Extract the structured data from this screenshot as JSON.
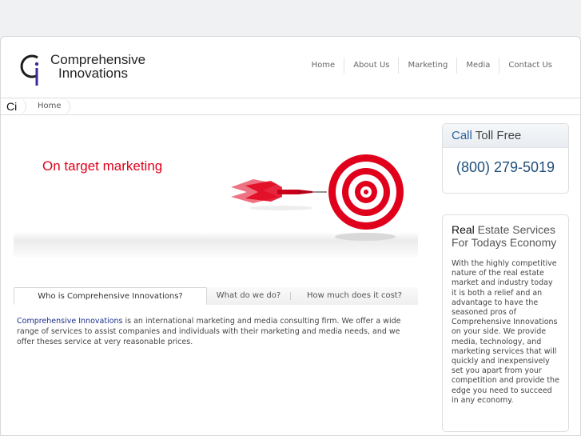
{
  "brand": {
    "line1": "Comprehensive",
    "line2": "Innovations",
    "mark": "ci-logo-mark"
  },
  "nav": {
    "items": [
      {
        "label": "Home"
      },
      {
        "label": "About Us"
      },
      {
        "label": "Marketing"
      },
      {
        "label": "Media"
      },
      {
        "label": "Contact Us"
      }
    ]
  },
  "breadcrumb": {
    "ci": "Ci",
    "home": "Home"
  },
  "hero": {
    "title": "On target marketing",
    "art": "dart-and-target-icon"
  },
  "tabs": [
    {
      "label": "Who is Comprehensive Innovations?"
    },
    {
      "label": "What do we do?"
    },
    {
      "label": "How much does it cost?"
    }
  ],
  "about": {
    "brand_link": "Comprehensive Innovations",
    "text": " is an international marketing and media consulting firm. We offer a wide range of services to assist companies and individuals with their marketing and media needs, and we offer theses service at very reasonable prices."
  },
  "call": {
    "highlight": "Call",
    "rest": " Toll Free",
    "number": "(800) 279-5019"
  },
  "realestate": {
    "highlight": "Real",
    "title_rest": " Estate Services For Todays Economy",
    "body": "With the highly competitive nature of the real estate market and industry today it is both a relief and an advantage to have the seasoned pros of Comprehensive Innovations on your side. We provide media, technology, and marketing services that will quickly and inexpensively set you apart from your competition and provide the edge you need to succeed in any economy."
  },
  "colors": {
    "accent_red": "#e0001b",
    "accent_blue": "#2a5f9e",
    "brand_blue": "#1a2f8a"
  }
}
